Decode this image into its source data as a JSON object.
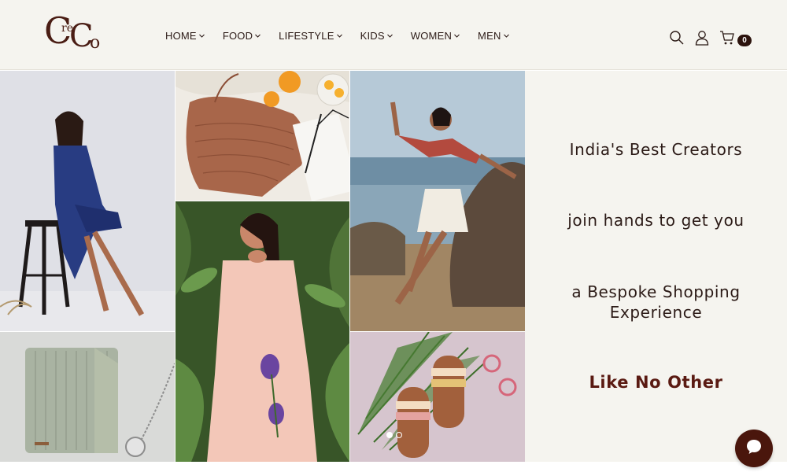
{
  "brand": {
    "logo_c1": "C",
    "logo_re": "re",
    "logo_c2": "C",
    "logo_o": "o"
  },
  "nav": {
    "items": [
      {
        "label": "HOME"
      },
      {
        "label": "FOOD"
      },
      {
        "label": "LIFESTYLE"
      },
      {
        "label": "KIDS"
      },
      {
        "label": "WOMEN"
      },
      {
        "label": "MEN"
      }
    ]
  },
  "header_icons": [
    "search-icon",
    "user-icon",
    "cart-icon"
  ],
  "cart": {
    "count": "0"
  },
  "hero": {
    "line1": "India's Best Creators",
    "line2": "join hands to get you",
    "line3": "a Bespoke Shopping Experience",
    "line4": "Like No Other"
  },
  "slider": {
    "active_index": 0,
    "total": 2
  },
  "colors": {
    "accent": "#4a160c",
    "header_bg": "#f5f4ef",
    "text": "#2b1a16"
  }
}
